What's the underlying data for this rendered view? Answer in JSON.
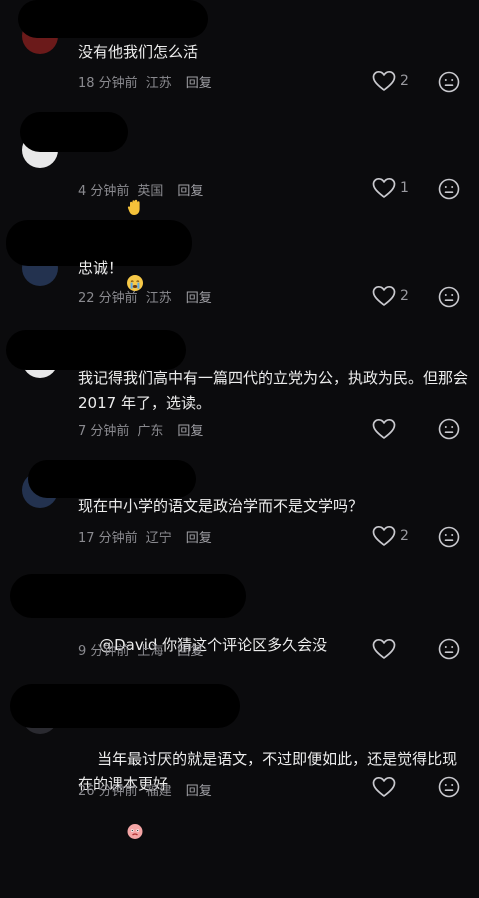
{
  "comments": [
    {
      "text": "没有他我们怎么活",
      "time": "18 分钟前",
      "region": "江苏",
      "reply": "回复",
      "likes": "2"
    },
    {
      "text": "",
      "emojis": "✋😭✋",
      "time": "4 分钟前",
      "region": "英国",
      "reply": "回复",
      "likes": "1"
    },
    {
      "text": "忠诚！",
      "time": "22 分钟前",
      "region": "江苏",
      "reply": "回复",
      "likes": "2"
    },
    {
      "text": "我记得我们高中有一篇四代的立党为公，执政为民。但那会 2017 年了，选读。",
      "time": "7 分钟前",
      "region": "广东",
      "reply": "回复",
      "likes": ""
    },
    {
      "text": "现在中小学的语文是政治学而不是文学吗？",
      "time": "17 分钟前",
      "region": "辽宁",
      "reply": "回复",
      "likes": "2"
    },
    {
      "text": "@David 你猜这个评论区多久会没",
      "time": "9 分钟前",
      "region": "上海",
      "reply": "回复",
      "likes": ""
    },
    {
      "text": "当年最讨厌的就是语文，不过即便如此，还是觉得比现在的课本更好",
      "time": "26 分钟前",
      "region": "福建",
      "reply": "回复",
      "likes": ""
    }
  ],
  "icons": {
    "like": "heart-outline-icon",
    "dislike": "neutral-face-icon"
  }
}
